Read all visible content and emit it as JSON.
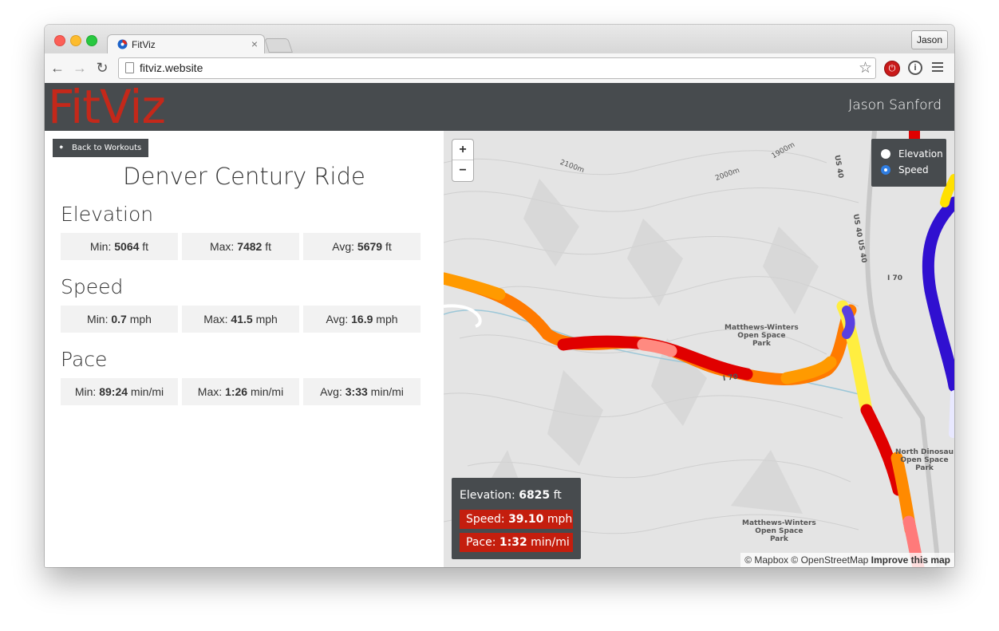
{
  "browser": {
    "tab_title": "FitViz",
    "tab_close": "×",
    "profile_label": "Jason",
    "url": "fitviz.website",
    "icons": [
      "back-arrow-icon",
      "forward-arrow-icon",
      "reload-icon",
      "page-icon",
      "bookmark-star-icon",
      "stop-extension-icon",
      "info-extension-icon",
      "menu-icon"
    ]
  },
  "app": {
    "logo": "FitViz",
    "user_name": "Jason Sanford",
    "back_label": "Back to Workouts",
    "ride_title": "Denver Century Ride"
  },
  "stats": {
    "elevation": {
      "title": "Elevation",
      "items": [
        {
          "label": "Min:",
          "value": "5064",
          "unit": "ft"
        },
        {
          "label": "Max:",
          "value": "7482",
          "unit": "ft"
        },
        {
          "label": "Avg:",
          "value": "5679",
          "unit": "ft"
        }
      ]
    },
    "speed": {
      "title": "Speed",
      "items": [
        {
          "label": "Min:",
          "value": "0.7",
          "unit": "mph"
        },
        {
          "label": "Max:",
          "value": "41.5",
          "unit": "mph"
        },
        {
          "label": "Avg:",
          "value": "16.9",
          "unit": "mph"
        }
      ]
    },
    "pace": {
      "title": "Pace",
      "items": [
        {
          "label": "Min:",
          "value": "89:24",
          "unit": "min/mi"
        },
        {
          "label": "Max:",
          "value": "1:26",
          "unit": "min/mi"
        },
        {
          "label": "Avg:",
          "value": "3:33",
          "unit": "min/mi"
        }
      ]
    }
  },
  "map": {
    "zoom_in": "+",
    "zoom_out": "−",
    "layer_options": [
      {
        "label": "Elevation",
        "checked": false
      },
      {
        "label": "Speed",
        "checked": true
      }
    ],
    "readout": {
      "elevation_label": "Elevation:",
      "elevation_value": "6825",
      "elevation_unit": "ft",
      "speed_label": "Speed:",
      "speed_value": "39.10",
      "speed_unit": "mph",
      "pace_label": "Pace:",
      "pace_value": "1:32",
      "pace_unit": "min/mi"
    },
    "attribution": {
      "mapbox": "© Mapbox",
      "osm": "© OpenStreetMap",
      "improve": "Improve this map"
    },
    "labels": {
      "park1": "Matthews-Winters\nOpen Space\nPark",
      "park2": "North Dinosau\nOpen Space\nPark",
      "park3": "Matthews-Winters\nOpen Space\nPark",
      "road_us40": "US 40",
      "road_us40_2": "US 40 US 40",
      "road_i70": "I 70",
      "road_i70_2": "I 70",
      "contour1": "2100m",
      "contour2": "2000m",
      "contour3": "1900m"
    },
    "track_colors": {
      "fast": "#e00000",
      "medium": "#ff7a00",
      "slow": "#ffe000",
      "slowest": "#3010d0"
    }
  }
}
